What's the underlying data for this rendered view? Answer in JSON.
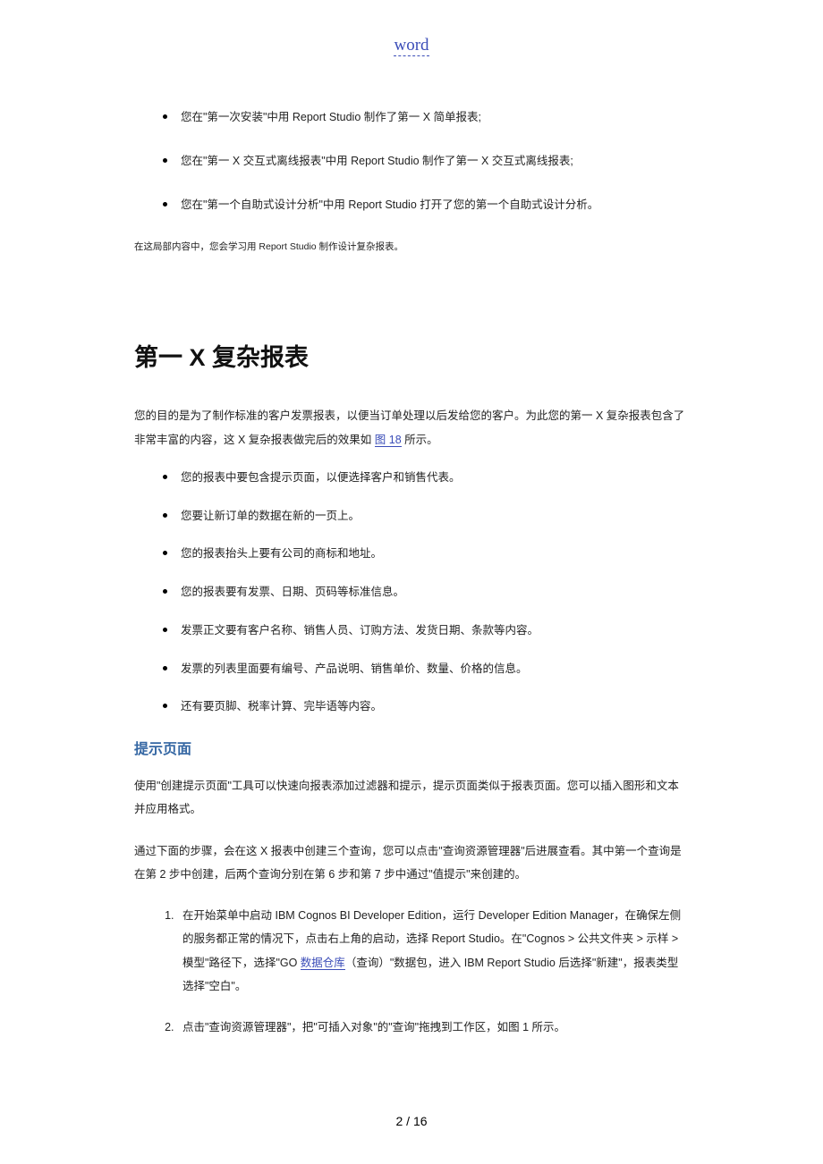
{
  "header": {
    "linkText": "word"
  },
  "topBullets": {
    "b1": "您在\"第一次安装\"中用 Report Studio 制作了第一 X 简单报表;",
    "b2": "您在\"第一 X 交互式离线报表\"中用 Report Studio 制作了第一 X 交互式离线报表;",
    "b3": "您在\"第一个自助式设计分析\"中用 Report Studio 打开了您的第一个自助式设计分析。"
  },
  "note": "在这局部内容中，您会学习用 Report Studio 制作设计复杂报表。",
  "title": "第一 X 复杂报表",
  "intro": {
    "pre": "您的目的是为了制作标准的客户发票报表，以便当订单处理以后发给您的客户。为此您的第一 X 复杂报表包含了非常丰富的内容，这 X 复杂报表做完后的效果如 ",
    "linkText": "图 18",
    "post": " 所示。"
  },
  "midBullets": {
    "m1": "您的报表中要包含提示页面，以便选择客户和销售代表。",
    "m2": "您要让新订单的数据在新的一页上。",
    "m3": "您的报表抬头上要有公司的商标和地址。",
    "m4": "您的报表要有发票、日期、页码等标准信息。",
    "m5": "发票正文要有客户名称、销售人员、订购方法、发货日期、条款等内容。",
    "m6": "发票的列表里面要有编号、产品说明、销售单价、数量、价格的信息。",
    "m7": "还有要页脚、税率计算、完毕语等内容。"
  },
  "section": {
    "heading": "提示页面"
  },
  "p2": "使用\"创建提示页面\"工具可以快速向报表添加过滤器和提示，提示页面类似于报表页面。您可以插入图形和文本并应用格式。",
  "p3": "通过下面的步骤，会在这 X 报表中创建三个查询，您可以点击\"查询资源管理器\"后进展查看。其中第一个查询是在第 2 步中创建，后两个查询分别在第 6 步和第 7 步中通过\"值提示\"来创建的。",
  "steps": {
    "s1pre": "在开始菜单中启动 IBM Cognos BI Developer Edition，运行 Developer Edition Manager，在确保左侧的服务都正常的情况下，点击右上角的启动，选择 Report Studio。在\"Cognos > 公共文件夹 > 示样 > 模型\"路径下，选择\"GO ",
    "s1link": "数据仓库",
    "s1post": "（查询）\"数据包，进入 IBM Report Studio 后选择\"新建\"，报表类型选择\"空白\"。",
    "s2": "点击\"查询资源管理器\"，把\"可插入对象\"的\"查询\"拖拽到工作区，如图 1 所示。"
  },
  "footer": {
    "pageLabel": "2 / 16"
  }
}
